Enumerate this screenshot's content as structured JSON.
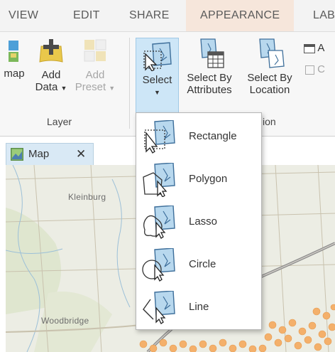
{
  "tabs": {
    "view": "VIEW",
    "edit": "EDIT",
    "share": "SHARE",
    "appearance": "APPEARANCE",
    "labeling": "LAB"
  },
  "ribbon": {
    "basemap_label": "map",
    "add_data_line1": "Add",
    "add_data_line2": "Data",
    "add_preset_line1": "Add",
    "add_preset_line2": "Preset",
    "layer_group": "Layer",
    "select_label": "Select",
    "select_by_attributes_line1": "Select By",
    "select_by_attributes_line2": "Attributes",
    "select_by_location_line1": "Select By",
    "select_by_location_line2": "Location",
    "selection_group_fragment": "ion",
    "attributes_fragment": "A",
    "clear_fragment": "C"
  },
  "select_menu": [
    {
      "label": "Rectangle",
      "icon": "select-rectangle-icon"
    },
    {
      "label": "Polygon",
      "icon": "select-polygon-icon"
    },
    {
      "label": "Lasso",
      "icon": "select-lasso-icon"
    },
    {
      "label": "Circle",
      "icon": "select-circle-icon"
    },
    {
      "label": "Line",
      "icon": "select-line-icon"
    }
  ],
  "map_tab": {
    "name": "Map",
    "close": "✕"
  },
  "map_places": {
    "kleinburg": "Kleinburg",
    "woodbridge": "Woodbridge"
  },
  "colors": {
    "select_active_bg": "#cde6f7",
    "appearance_tab_bg": "#f6e6db",
    "map_bg": "#ecede4",
    "selected_features": "#f4b06b"
  }
}
